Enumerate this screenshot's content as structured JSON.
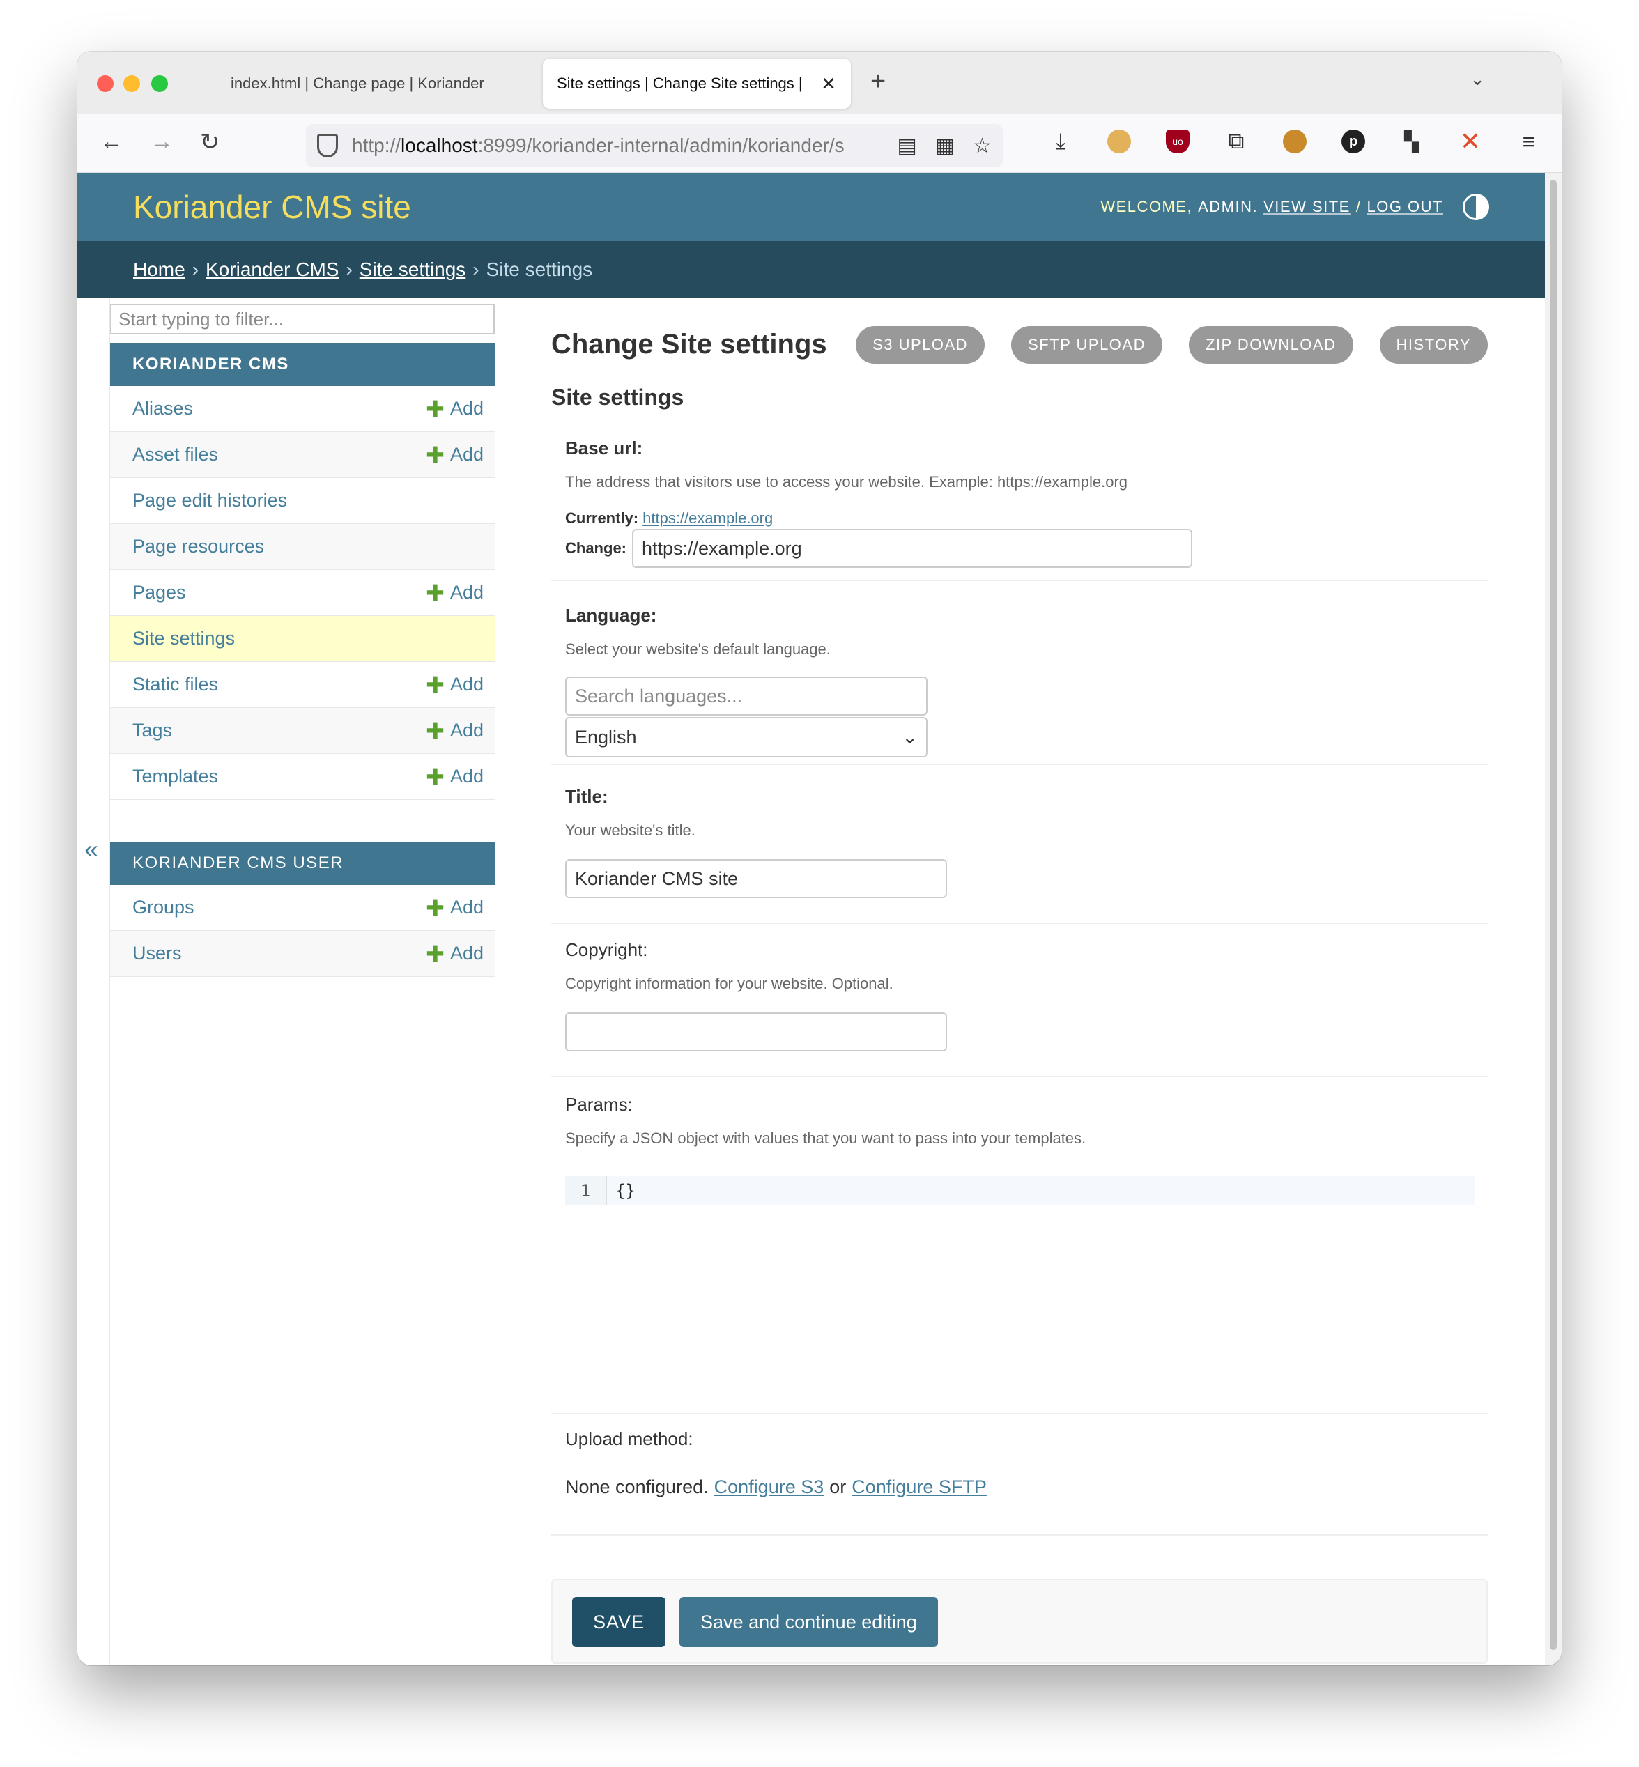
{
  "browser": {
    "tabs": [
      {
        "title": "index.html | Change page | Koriander",
        "close": "✕"
      },
      {
        "title": "Site settings | Change Site settings |",
        "close": "✕"
      }
    ],
    "new_tab": "+",
    "tab_menu": "⌄",
    "url_prefix": "http://",
    "url_host": "localhost",
    "url_rest": ":8999/koriander-internal/admin/koriander/s",
    "icons": {
      "back": "arrow-left-icon",
      "forward": "arrow-right-icon",
      "reload": "reload-icon"
    }
  },
  "header": {
    "site_title": "Koriander CMS site",
    "welcome": "WELCOME,",
    "user": "ADMIN.",
    "view_site": "VIEW SITE",
    "sep": "/",
    "log_out": "LOG OUT"
  },
  "breadcrumbs": {
    "home": "Home",
    "app": "Koriander CMS",
    "model": "Site settings",
    "current": "Site settings",
    "sep": "›"
  },
  "sidebar": {
    "filter_placeholder": "Start typing to filter...",
    "collapse": "«",
    "modules": [
      {
        "caption": "KORIANDER CMS",
        "models": [
          {
            "name": "Aliases",
            "add": "Add"
          },
          {
            "name": "Asset files",
            "add": "Add"
          },
          {
            "name": "Page edit histories",
            "add": ""
          },
          {
            "name": "Page resources",
            "add": ""
          },
          {
            "name": "Pages",
            "add": "Add"
          },
          {
            "name": "Site settings",
            "add": ""
          },
          {
            "name": "Static files",
            "add": "Add"
          },
          {
            "name": "Tags",
            "add": "Add"
          },
          {
            "name": "Templates",
            "add": "Add"
          }
        ]
      },
      {
        "caption": "KORIANDER CMS USER",
        "models": [
          {
            "name": "Groups",
            "add": "Add"
          },
          {
            "name": "Users",
            "add": "Add"
          }
        ]
      }
    ],
    "add_plus": "✚"
  },
  "content": {
    "title": "Change Site settings",
    "object_tools": [
      "S3 UPLOAD",
      "SFTP UPLOAD",
      "ZIP DOWNLOAD",
      "HISTORY"
    ],
    "fieldset": "Site settings",
    "base_url": {
      "label": "Base url:",
      "help": "The address that visitors use to access your website. Example: https://example.org",
      "currently_label": "Currently:",
      "currently_value": "https://example.org",
      "change_label": "Change:",
      "value": "https://example.org"
    },
    "language": {
      "label": "Language:",
      "help": "Select your website's default language.",
      "search_placeholder": "Search languages...",
      "selected": "English",
      "chevron": "⌄"
    },
    "title_field": {
      "label": "Title:",
      "help": "Your website's title.",
      "value": "Koriander CMS site"
    },
    "copyright": {
      "label": "Copyright:",
      "help": "Copyright information for your website. Optional.",
      "value": ""
    },
    "params": {
      "label": "Params:",
      "help": "Specify a JSON object with values that you want to pass into your templates.",
      "line_no": "1",
      "code": "{}"
    },
    "upload_method": {
      "label": "Upload method:",
      "text": "None configured.",
      "link_s3": "Configure S3",
      "or": "or",
      "link_sftp": "Configure SFTP"
    },
    "buttons": {
      "save": "SAVE",
      "save_continue": "Save and continue editing"
    }
  },
  "colors": {
    "header_bg": "#417690",
    "breadcrumb_bg": "#264b5d",
    "site_title": "#f5dd5d",
    "link": "#447e9b",
    "add_plus": "#5aa02c",
    "current_row": "#ffffcc",
    "save_button": "#205067"
  }
}
